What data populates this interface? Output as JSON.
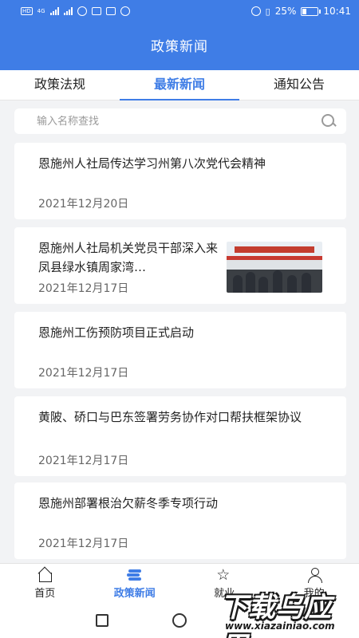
{
  "status_bar": {
    "time": "10:41",
    "battery": "25%",
    "battery_level": 0.25,
    "network_left": "HD",
    "network_speed": "4G"
  },
  "header": {
    "title": "政策新闻"
  },
  "tabs": [
    {
      "label": "政策法规",
      "active": false
    },
    {
      "label": "最新新闻",
      "active": true
    },
    {
      "label": "通知公告",
      "active": false
    }
  ],
  "search": {
    "placeholder": "输入名称查找",
    "value": ""
  },
  "news": [
    {
      "title": "恩施州人社局传达学习州第八次党代会精神",
      "date": "2021年12月20日",
      "has_image": false
    },
    {
      "title": "恩施州人社局机关党员干部深入来凤县绿水镇周家湾…",
      "date": "2021年12月17日",
      "has_image": true
    },
    {
      "title": "恩施州工伤预防项目正式启动",
      "date": "2021年12月17日",
      "has_image": false
    },
    {
      "title": "黄陂、硚口与巴东签署劳务协作对口帮扶框架协议",
      "date": "2021年12月17日",
      "has_image": false
    },
    {
      "title": "恩施州部署根治欠薪冬季专项行动",
      "date": "2021年12月17日",
      "has_image": false
    }
  ],
  "bottom_nav": [
    {
      "label": "首页",
      "icon": "home-icon",
      "active": false
    },
    {
      "label": "政策新闻",
      "icon": "news-icon",
      "active": true
    },
    {
      "label": "就业",
      "icon": "star-icon",
      "active": false
    },
    {
      "label": "我的",
      "icon": "user-icon",
      "active": false
    }
  ],
  "watermark": {
    "text": "下载乌应用",
    "url": "www.xiazainiao.com"
  },
  "colors": {
    "primary": "#3f7de6",
    "background": "#f2f3f5"
  }
}
